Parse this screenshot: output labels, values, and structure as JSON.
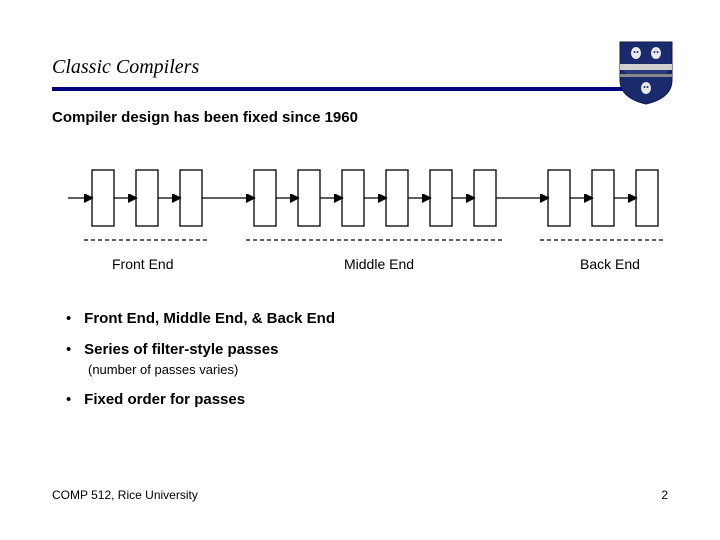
{
  "title": "Classic Compilers",
  "subtitle": "Compiler design has been fixed since 1960",
  "diagram": {
    "front_label": "Front End",
    "middle_label": "Middle End",
    "back_label": "Back End"
  },
  "bullets": [
    {
      "text": "Front End, Middle End, & Back End"
    },
    {
      "text": "Series of filter-style passes",
      "sub": "(number of passes varies)"
    },
    {
      "text": "Fixed order for passes"
    }
  ],
  "footer": {
    "left": "COMP 512, Rice University",
    "page": "2"
  }
}
